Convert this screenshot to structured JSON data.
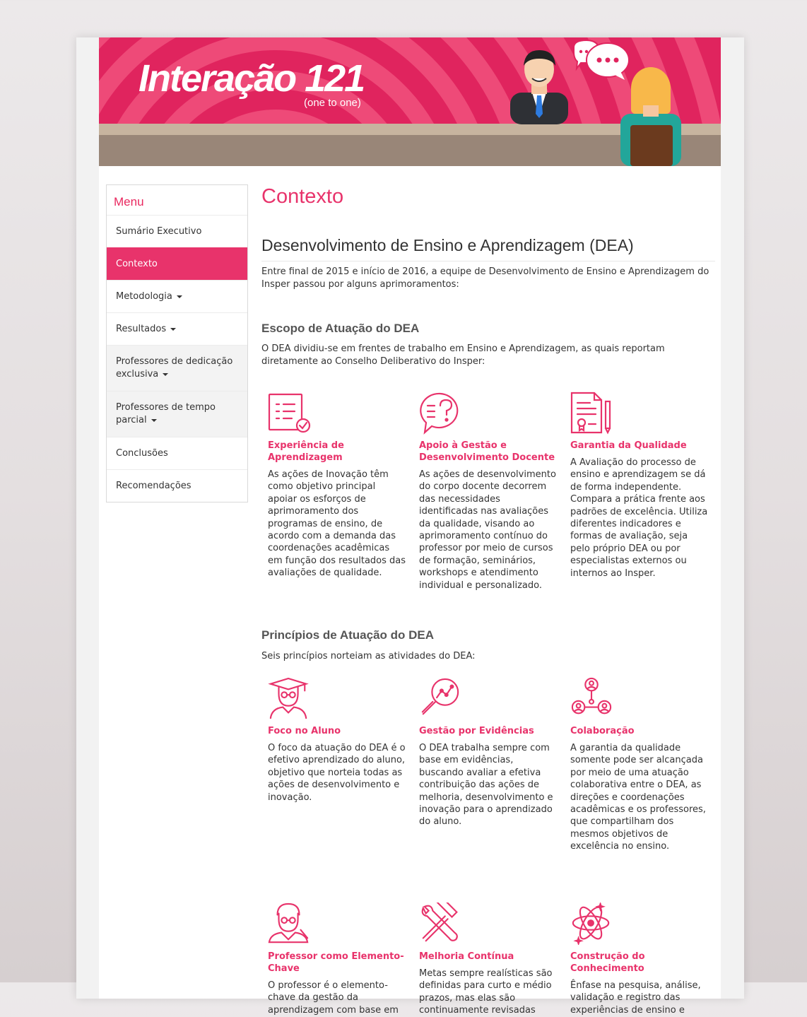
{
  "brand": {
    "title": "Interação 121",
    "subtitle": "(one to one)"
  },
  "colors": {
    "accent": "#e8336b",
    "banner": "#e0245e",
    "floor": "#998678"
  },
  "menu": {
    "title": "Menu",
    "items": [
      {
        "label": "Sumário Executivo"
      },
      {
        "label": "Contexto"
      },
      {
        "label": "Metodologia"
      },
      {
        "label": "Resultados"
      },
      {
        "label": "Professores de dedicação exclusiva"
      },
      {
        "label": "Professores de tempo parcial"
      },
      {
        "label": "Conclusões"
      },
      {
        "label": "Recomendações"
      }
    ]
  },
  "content": {
    "page_title": "Contexto",
    "section_title": "Desenvolvimento de Ensino e Aprendizagem (DEA)",
    "intro": "Entre final de 2015 e início de 2016, a equipe de Desenvolvimento de Ensino e Aprendizagem do Insper passou por alguns aprimoramentos:",
    "scope": {
      "title": "Escopo de Atuação do DEA",
      "text": "O DEA dividiu-se em frentes de trabalho em Ensino e Aprendizagem, as quais reportam diretamente ao Conselho Deliberativo do Insper:",
      "cards": [
        {
          "icon": "checklist-document-icon",
          "title": "Experiência de Aprendizagem",
          "text": "As ações de Inovação têm como objetivo principal apoiar os esforços de aprimoramento dos programas de ensino, de acordo com a demanda das coordenações acadêmicas em função dos resultados das avaliações de qualidade."
        },
        {
          "icon": "question-bubble-icon",
          "title": "Apoio à Gestão e Desenvolvimento Docente",
          "text": "As ações de desenvolvimento do corpo docente decorrem das necessidades identificadas nas avaliações da qualidade, visando ao aprimoramento contínuo do professor por meio de cursos de formação, seminários, workshops e atendimento individual e personalizado."
        },
        {
          "icon": "certificate-pencil-icon",
          "title": "Garantia da Qualidade",
          "text": "A Avaliação do processo de ensino e aprendizagem se dá de forma independente. Compara a prática frente aos padrões de excelência. Utiliza diferentes indicadores e formas de avaliação, seja pelo próprio DEA ou por especialistas externos ou internos ao Insper."
        }
      ]
    },
    "principles": {
      "title": "Princípios de Atuação do DEA",
      "text": "Seis princípios norteiam as atividades do DEA:",
      "cards": [
        {
          "icon": "graduate-student-icon",
          "title": "Foco no Aluno",
          "text": "O foco da atuação do DEA é o efetivo aprendizado do aluno, objetivo que norteia todas as ações de desenvolvimento e inovação."
        },
        {
          "icon": "magnifier-chart-icon",
          "title": "Gestão por Evidências",
          "text": "O DEA trabalha sempre com base em evidências, buscando avaliar a efetiva contribuição das ações de melhoria, desenvolvimento e inovação para o aprendizado do aluno."
        },
        {
          "icon": "people-network-icon",
          "title": "Colaboração",
          "text": "A garantia da qualidade somente pode ser alcançada por meio de uma atuação colaborativa entre o DEA, as direções e coordenações acadêmicas e os professores, que compartilham dos mesmos objetivos de excelência no ensino."
        },
        {
          "icon": "teacher-icon",
          "title": "Professor como Elemento-Chave",
          "text": "O professor é o elemento-chave da gestão da aprendizagem com base em"
        },
        {
          "icon": "hammer-wrench-icon",
          "title": "Melhoria Contínua",
          "text": "Metas sempre realísticas são definidas para curto e médio prazos, mas elas são continuamente revisadas"
        },
        {
          "icon": "atom-icon",
          "title": "Construção do Conhecimento",
          "text": "Ênfase na pesquisa, análise, validação e registro das experiências de ensino e"
        }
      ]
    }
  }
}
